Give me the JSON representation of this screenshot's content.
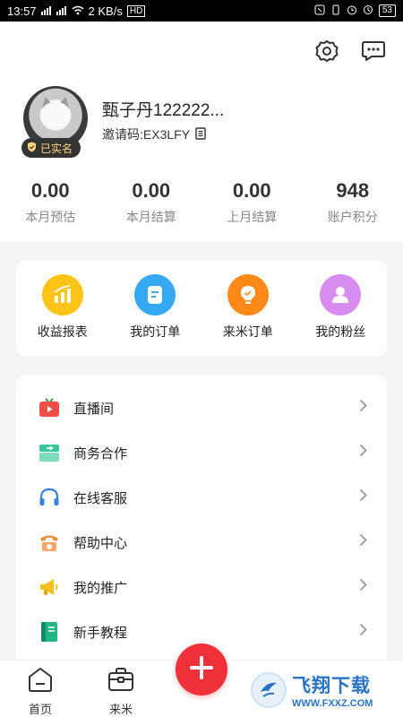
{
  "status_bar": {
    "time": "13:57",
    "signal_left": "4G",
    "signal_right": "4G",
    "net_speed": "2 KB/s",
    "hd_label": "HD",
    "battery": "53"
  },
  "header": {
    "username": "甄子丹122222...",
    "invite_code": "邀请码:EX3LFY",
    "verified_label": "已实名",
    "settings_icon": "gear-icon",
    "message_icon": "chat-icon"
  },
  "stats": [
    {
      "value": "0.00",
      "label": "本月预估"
    },
    {
      "value": "0.00",
      "label": "本月结算"
    },
    {
      "value": "0.00",
      "label": "上月结算"
    },
    {
      "value": "948",
      "label": "账户积分"
    }
  ],
  "quick_actions": [
    {
      "label": "收益报表",
      "icon": "chart-icon",
      "color": "#ffc417"
    },
    {
      "label": "我的订单",
      "icon": "order-icon",
      "color": "#36a9f5"
    },
    {
      "label": "来米订单",
      "icon": "bulb-icon",
      "color": "#ff8a18"
    },
    {
      "label": "我的粉丝",
      "icon": "fans-icon",
      "color": "#d78cf0"
    }
  ],
  "menu": [
    {
      "label": "直播间",
      "icon": "tv-icon"
    },
    {
      "label": "商务合作",
      "icon": "business-icon"
    },
    {
      "label": "在线客服",
      "icon": "headset-icon"
    },
    {
      "label": "帮助中心",
      "icon": "phone-icon"
    },
    {
      "label": "我的推广",
      "icon": "megaphone-icon"
    },
    {
      "label": "新手教程",
      "icon": "book-icon"
    }
  ],
  "bottom_nav": {
    "home_label": "首页",
    "laimi_label": "来米"
  },
  "watermark": {
    "title": "飞翔下载",
    "url": "WWW.FXXZ.COM"
  },
  "colors": {
    "accent_red": "#f0313a",
    "text_gray": "#888888"
  }
}
